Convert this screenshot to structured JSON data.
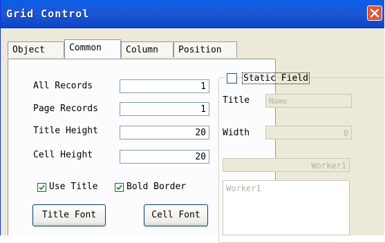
{
  "window": {
    "title": "Grid Control",
    "close_label": "×"
  },
  "tabs": [
    {
      "label": "Object",
      "active": false
    },
    {
      "label": "Common",
      "active": true
    },
    {
      "label": "Column",
      "active": false
    },
    {
      "label": "Position",
      "active": false
    }
  ],
  "common": {
    "all_records": {
      "label": "All Records",
      "value": "1"
    },
    "page_records": {
      "label": "Page Records",
      "value": "1"
    },
    "title_height": {
      "label": "Title Height",
      "value": "20"
    },
    "cell_height": {
      "label": "Cell Height",
      "value": "20"
    },
    "use_title": {
      "label": "Use Title",
      "checked": true
    },
    "bold_border": {
      "label": "Bold Border",
      "checked": true
    },
    "title_font_button": "Title Font",
    "cell_font_button": "Cell Font"
  },
  "static_field": {
    "label": "Static Field",
    "checked": false,
    "title_label": "Title",
    "title_value": "Name",
    "width_label": "Width",
    "width_value": "0",
    "combo_value": "Worker1",
    "list_items": [
      "Worker1"
    ]
  },
  "colors": {
    "titlebar": "#0A5FE8",
    "dialog_bg": "#ECE9D8",
    "panel_bg": "#FCFCFE",
    "close_button": "#E0543C",
    "disabled_text": "#B4B2A6"
  }
}
